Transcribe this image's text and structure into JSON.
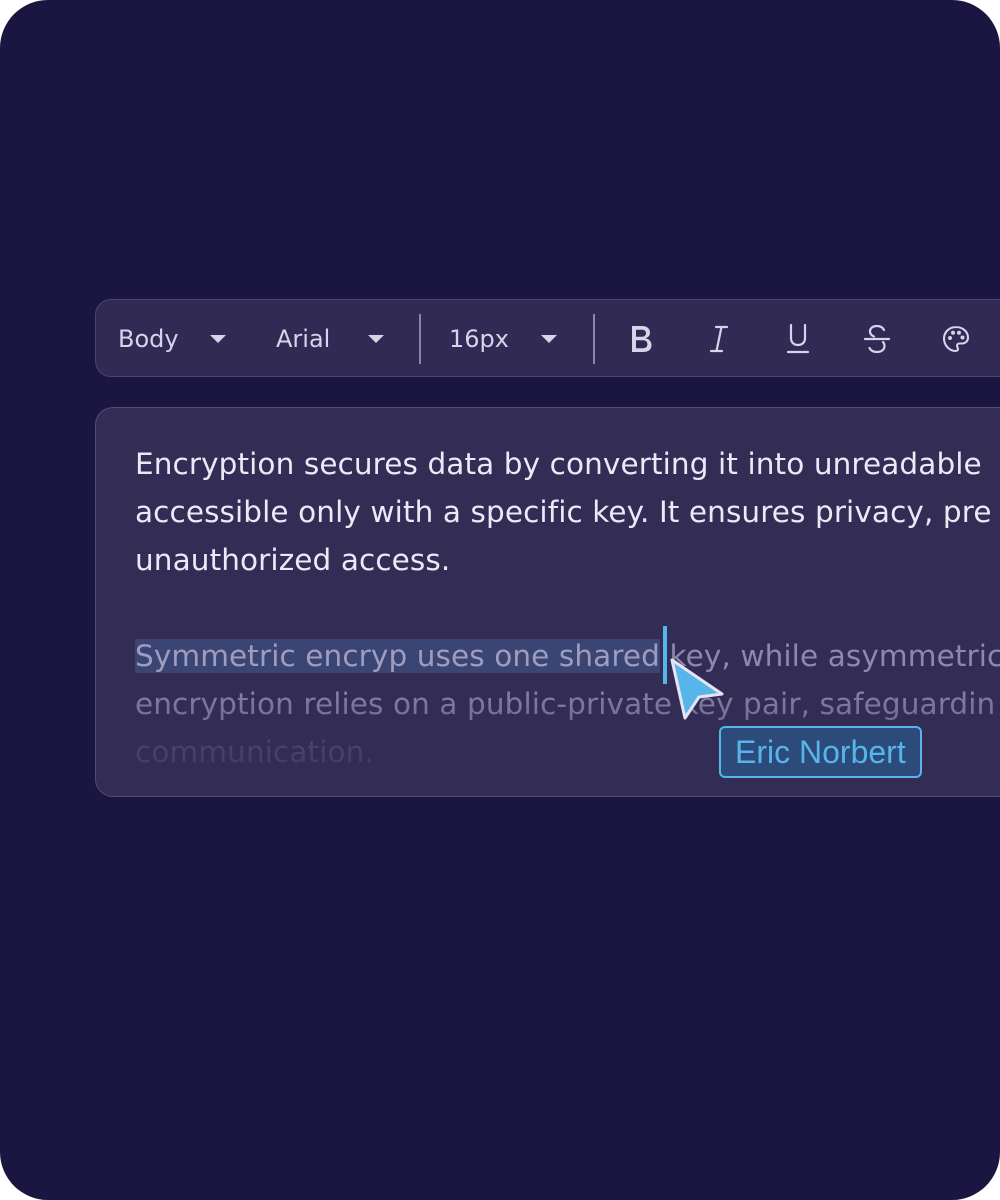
{
  "toolbar": {
    "style_select": "Body",
    "font_select": "Arial",
    "size_select": "16px",
    "buttons": [
      {
        "name": "bold",
        "icon": "bold-icon"
      },
      {
        "name": "italic",
        "icon": "italic-icon"
      },
      {
        "name": "underline",
        "icon": "underline-icon"
      },
      {
        "name": "strikethrough",
        "icon": "strikethrough-icon"
      },
      {
        "name": "color",
        "icon": "palette-icon"
      }
    ]
  },
  "editor": {
    "paragraph1": {
      "line1": "Encryption secures data by converting it into unreadable",
      "line2": "accessible only with a specific key. It ensures privacy, pre",
      "line3": "unauthorized access."
    },
    "paragraph2": {
      "selected": "Symmetric encryp uses one shared",
      "line1_rest": " key, while asymmetric",
      "line2": "encryption relies on a public-private key pair, safeguardin",
      "line3": "communication."
    }
  },
  "collaborator": {
    "name": "Eric Norbert",
    "color": "#56b6ea"
  },
  "colors": {
    "background": "#1b1541",
    "panel": "#332c55",
    "toolbar": "#302a55",
    "selection": "#3a4573",
    "accent": "#56b6ea"
  }
}
